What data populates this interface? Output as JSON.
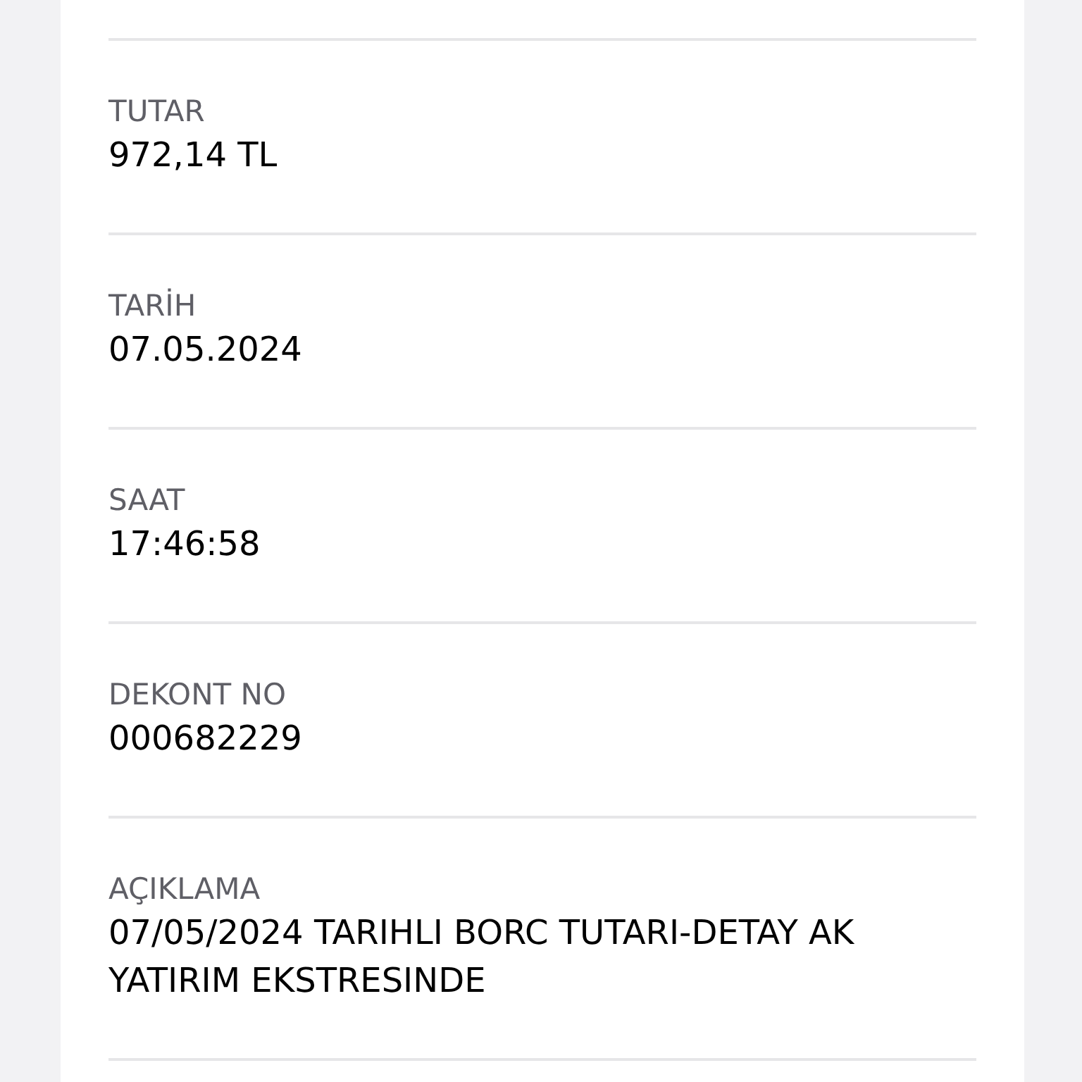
{
  "fields": [
    {
      "label": "TUTAR",
      "value": "972,14 TL"
    },
    {
      "label": "TARİH",
      "value": "07.05.2024"
    },
    {
      "label": "SAAT",
      "value": "17:46:58"
    },
    {
      "label": "DEKONT NO",
      "value": "000682229"
    },
    {
      "label": "AÇIKLAMA",
      "value": "07/05/2024 TARIHLI BORC TUTARI-DETAY AK YATIRIM EKSTRESINDE"
    }
  ]
}
